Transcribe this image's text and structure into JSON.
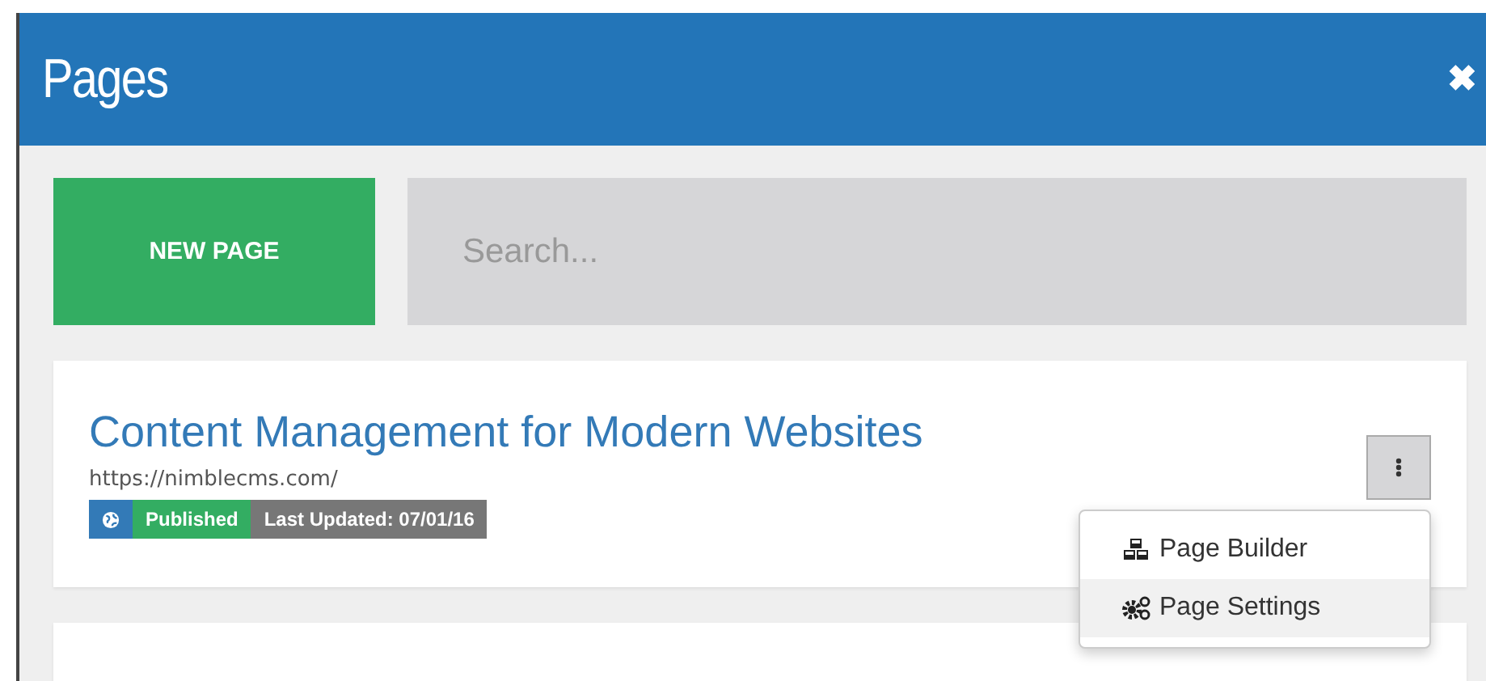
{
  "window": {
    "title": "Pages",
    "close": "✖"
  },
  "toolbar": {
    "new_button": "NEW PAGE",
    "search": {
      "placeholder": "Search..."
    }
  },
  "pages": [
    {
      "title": "Content Management for Modern Websites",
      "url": "https://nimblecms.com/",
      "status": "Published",
      "updated": "Last Updated: 07/01/16",
      "menu_open": true
    }
  ],
  "menu": [
    {
      "label": "Page Builder",
      "kind": "builder",
      "selected": false
    },
    {
      "label": "Page Settings",
      "kind": "settings",
      "selected": true
    }
  ]
}
